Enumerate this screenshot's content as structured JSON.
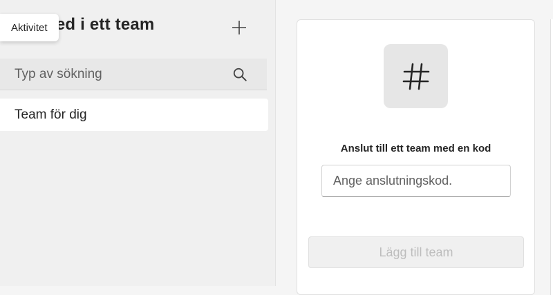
{
  "sidebar": {
    "title": "Gå med i ett team",
    "add_icon": "plus-icon",
    "search": {
      "placeholder": "Typ av sökning",
      "icon": "search-icon"
    },
    "items": [
      {
        "label": "Team för dig",
        "selected": true
      }
    ]
  },
  "tooltip": {
    "label": "Aktivitet"
  },
  "join_card": {
    "icon": "hash-icon",
    "icon_glyph": "#",
    "heading": "Anslut till ett team med en kod",
    "code_input": {
      "placeholder": "Ange anslutningskod."
    },
    "submit_label": "Lägg till team",
    "submit_disabled": true
  },
  "colors": {
    "sidebar_bg": "#f0f0f0",
    "selected_item_bg": "#ffffff",
    "disabled_text": "#bdbdbd",
    "icon_tile_bg": "#e6e6e6"
  }
}
